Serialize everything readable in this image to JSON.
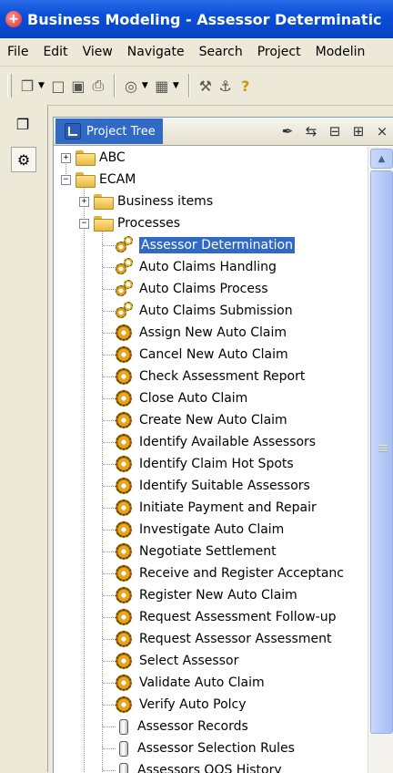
{
  "window": {
    "title": "Business Modeling - Assessor Determinatic"
  },
  "menu": [
    "File",
    "Edit",
    "View",
    "Navigate",
    "Search",
    "Project",
    "Modelin"
  ],
  "panel": {
    "title": "Project Tree",
    "close_label": "×"
  },
  "tree": {
    "roots": [
      {
        "label": "ABC",
        "expander": "+"
      },
      {
        "label": "ECAM",
        "expander": "−"
      }
    ],
    "ecam_children": [
      {
        "label": "Business items",
        "expander": "+"
      },
      {
        "label": "Processes",
        "expander": "−"
      }
    ],
    "processes": [
      {
        "label": "Assessor Determination",
        "icon": "gears-icon",
        "selected": true
      },
      {
        "label": "Auto Claims Handling",
        "icon": "gears-icon"
      },
      {
        "label": "Auto Claims Process",
        "icon": "gears-icon"
      },
      {
        "label": "Auto Claims Submission",
        "icon": "gears-icon"
      },
      {
        "label": "Assign New Auto Claim",
        "icon": "gear-icon"
      },
      {
        "label": "Cancel New Auto Claim",
        "icon": "gear-icon"
      },
      {
        "label": "Check Assessment Report",
        "icon": "gear-icon"
      },
      {
        "label": "Close Auto Claim",
        "icon": "gear-icon"
      },
      {
        "label": "Create New Auto Claim",
        "icon": "gear-icon"
      },
      {
        "label": "Identify Available Assessors",
        "icon": "gear-icon"
      },
      {
        "label": "Identify Claim Hot Spots",
        "icon": "gear-icon"
      },
      {
        "label": "Identify Suitable Assessors",
        "icon": "gear-icon"
      },
      {
        "label": "Initiate Payment and Repair",
        "icon": "gear-icon"
      },
      {
        "label": "Investigate Auto Claim",
        "icon": "gear-icon"
      },
      {
        "label": "Negotiate Settlement",
        "icon": "gear-icon"
      },
      {
        "label": "Receive and Register Acceptanc",
        "icon": "gear-icon"
      },
      {
        "label": "Register New Auto Claim",
        "icon": "gear-icon"
      },
      {
        "label": "Request Assessment Follow-up",
        "icon": "gear-icon"
      },
      {
        "label": "Request Assessor Assessment",
        "icon": "gear-icon"
      },
      {
        "label": "Select Assessor",
        "icon": "gear-icon"
      },
      {
        "label": "Validate Auto Claim",
        "icon": "gear-icon"
      },
      {
        "label": "Verify Auto Polcy",
        "icon": "gear-icon"
      },
      {
        "label": "Assessor Records",
        "icon": "datastore-icon"
      },
      {
        "label": "Assessor Selection Rules",
        "icon": "datastore-icon"
      },
      {
        "label": "Assessors QOS History",
        "icon": "datastore-icon"
      }
    ]
  }
}
